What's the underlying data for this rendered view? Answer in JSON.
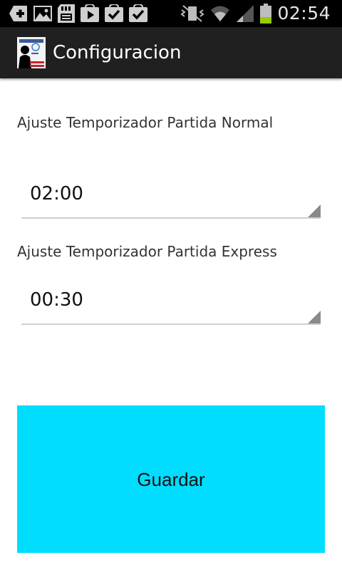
{
  "status_bar": {
    "time": "02:54",
    "left_icons": [
      "add-icon",
      "gallery-icon",
      "sd-card-icon",
      "play-store-icon",
      "download-done-icon",
      "download-done-icon"
    ],
    "right_icons": [
      "vibrate-icon",
      "wifi-icon",
      "signal-icon",
      "battery-icon"
    ]
  },
  "action_bar": {
    "title": "Configuracion",
    "logo_icon": "app-logo-icon",
    "background": "#202020"
  },
  "settings": {
    "normal": {
      "label": "Ajuste Temporizador Partida Normal",
      "value": "02:00"
    },
    "express": {
      "label": "Ajuste Temporizador Partida Express",
      "value": "00:30"
    }
  },
  "save_button": {
    "label": "Guardar",
    "color": "#00ddff"
  }
}
